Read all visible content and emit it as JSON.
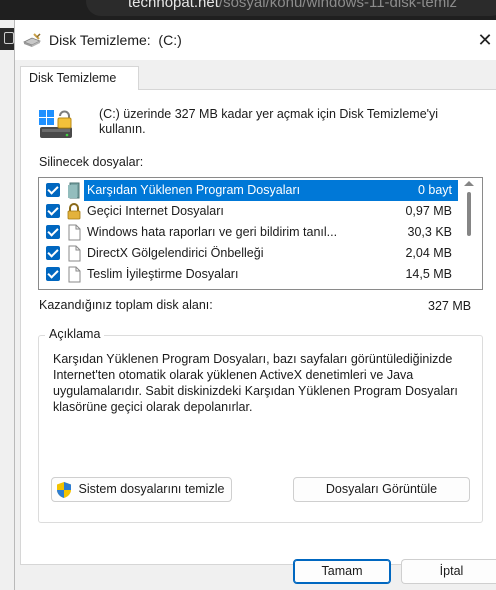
{
  "browser": {
    "url_host": "technopat.net",
    "url_path": "/sosyal/konu/windows-11-disk-temiz"
  },
  "window": {
    "title": "Disk Temizleme:  (C:)"
  },
  "tabs": [
    {
      "label": "Disk Temizleme"
    }
  ],
  "info": {
    "text": "(C:) üzerinde 327 MB kadar yer açmak için Disk Temizleme'yi kullanın."
  },
  "files": {
    "label": "Silinecek dosyalar:",
    "items": [
      {
        "name": "Karşıdan Yüklenen Program Dosyaları",
        "size": "0 bayt",
        "checked": true,
        "selected": true,
        "icon": "folder-icon"
      },
      {
        "name": "Geçici Internet Dosyaları",
        "size": "0,97 MB",
        "checked": true,
        "selected": false,
        "icon": "lock-icon"
      },
      {
        "name": "Windows hata raporları ve geri bildirim tanıl...",
        "size": "30,3 KB",
        "checked": true,
        "selected": false,
        "icon": "file-icon"
      },
      {
        "name": "DirectX Gölgelendirici Önbelleği",
        "size": "2,04 MB",
        "checked": true,
        "selected": false,
        "icon": "file-icon"
      },
      {
        "name": "Teslim İyileştirme Dosyaları",
        "size": "14,5 MB",
        "checked": true,
        "selected": false,
        "icon": "file-icon"
      }
    ]
  },
  "total": {
    "label": "Kazandığınız toplam disk alanı:",
    "value": "327 MB"
  },
  "description": {
    "title": "Açıklama",
    "text": "Karşıdan Yüklenen Program Dosyaları, bazı sayfaları görüntülediğinizde Internet'ten otomatik olarak yüklenen ActiveX denetimleri ve Java uygulamalarıdır. Sabit diskinizdeki Karşıdan Yüklenen Program Dosyaları klasörüne geçici olarak depolanırlar."
  },
  "buttons": {
    "system_files": "Sistem dosyalarını temizle",
    "view_files": "Dosyaları Görüntüle",
    "ok": "Tamam",
    "cancel": "İptal"
  },
  "colors": {
    "accent": "#0067c0",
    "selection": "#0078d7"
  }
}
